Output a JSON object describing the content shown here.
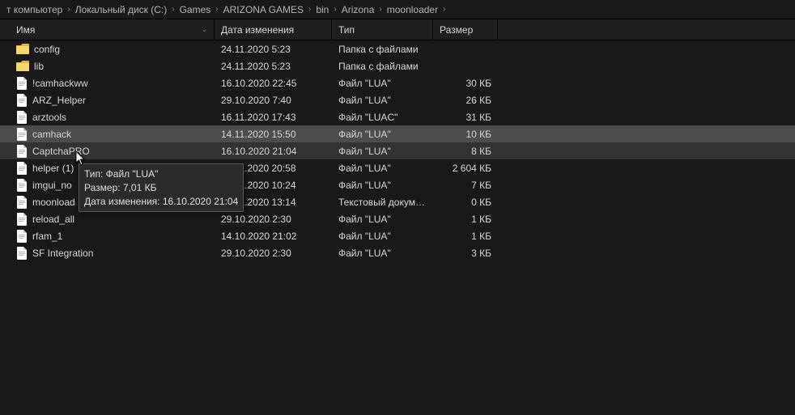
{
  "breadcrumb": {
    "items": [
      "т компьютер",
      "Локальный диск (C:)",
      "Games",
      "ARIZONA GAMES",
      "bin",
      "Arizona",
      "moonloader"
    ]
  },
  "headers": {
    "name": "Имя",
    "date": "Дата изменения",
    "type": "Тип",
    "size": "Размер"
  },
  "rows": [
    {
      "icon": "folder",
      "name": "config",
      "date": "24.11.2020 5:23",
      "type": "Папка с файлами",
      "size": "",
      "state": ""
    },
    {
      "icon": "folder",
      "name": "lib",
      "date": "24.11.2020 5:23",
      "type": "Папка с файлами",
      "size": "",
      "state": ""
    },
    {
      "icon": "file",
      "name": "!camhackww",
      "date": "16.10.2020 22:45",
      "type": "Файл \"LUA\"",
      "size": "30 КБ",
      "state": ""
    },
    {
      "icon": "file",
      "name": "ARZ_Helper",
      "date": "29.10.2020 7:40",
      "type": "Файл \"LUA\"",
      "size": "26 КБ",
      "state": ""
    },
    {
      "icon": "file",
      "name": "arztools",
      "date": "16.11.2020 17:43",
      "type": "Файл \"LUAC\"",
      "size": "31 КБ",
      "state": ""
    },
    {
      "icon": "file",
      "name": "camhack",
      "date": "14.11.2020 15:50",
      "type": "Файл \"LUA\"",
      "size": "10 КБ",
      "state": "selected"
    },
    {
      "icon": "file",
      "name": "CaptchaPRO",
      "date": "16.10.2020 21:04",
      "type": "Файл \"LUA\"",
      "size": "8 КБ",
      "state": "hover"
    },
    {
      "icon": "file",
      "name": "helper (1)",
      "date": "27.11.2020 20:58",
      "type": "Файл \"LUA\"",
      "size": "2 604 КБ",
      "state": ""
    },
    {
      "icon": "file",
      "name": "imgui_no",
      "date": "02.11.2020 10:24",
      "type": "Файл \"LUA\"",
      "size": "7 КБ",
      "state": ""
    },
    {
      "icon": "file",
      "name": "moonload",
      "date": "28.11.2020 13:14",
      "type": "Текстовый докум…",
      "size": "0 КБ",
      "state": ""
    },
    {
      "icon": "file",
      "name": "reload_all",
      "date": "29.10.2020 2:30",
      "type": "Файл \"LUA\"",
      "size": "1 КБ",
      "state": ""
    },
    {
      "icon": "file",
      "name": "rfam_1",
      "date": "14.10.2020 21:02",
      "type": "Файл \"LUA\"",
      "size": "1 КБ",
      "state": ""
    },
    {
      "icon": "file",
      "name": "SF Integration",
      "date": "29.10.2020 2:30",
      "type": "Файл \"LUA\"",
      "size": "3 КБ",
      "state": ""
    }
  ],
  "tooltip": {
    "line1": "Тип: Файл \"LUA\"",
    "line2": "Размер: 7,01 КБ",
    "line3": "Дата изменения: 16.10.2020 21:04"
  }
}
